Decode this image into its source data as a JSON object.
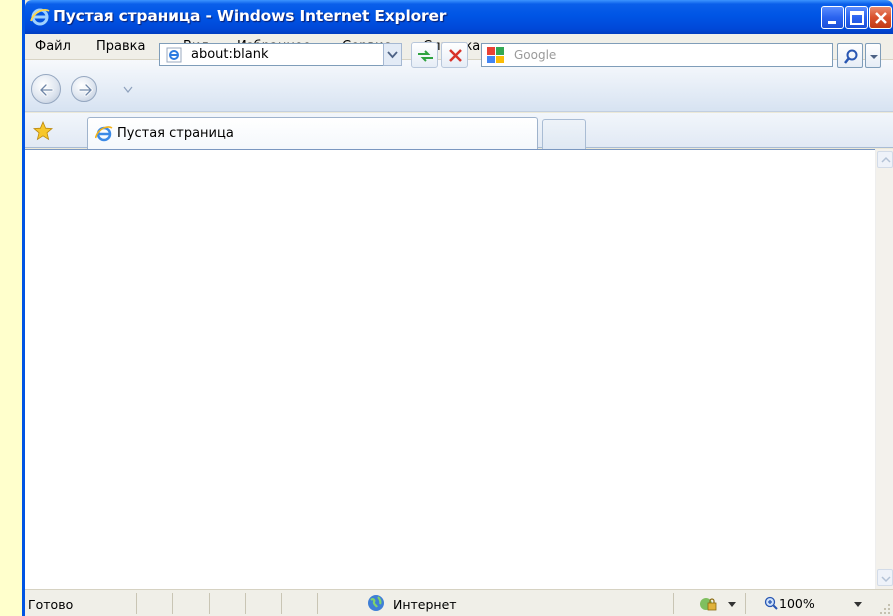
{
  "window": {
    "title": "Пустая страница - Windows Internet Explorer",
    "title_icon": "ie-logo-icon",
    "controls": [
      "minimize-icon",
      "maximize-icon",
      "close-icon"
    ]
  },
  "menu": {
    "items": [
      "Файл",
      "Правка",
      "Вид",
      "Избранное",
      "Сервис",
      "Справка"
    ]
  },
  "navigation": {
    "back_icon": "back-arrow-icon",
    "forward_icon": "forward-arrow-icon",
    "address_value": "about:blank",
    "refresh_icon": "refresh-icon",
    "stop_icon": "stop-icon",
    "search_placeholder": "Google",
    "search_provider_icon": "google-logo-icon",
    "search_button_icon": "magnifier-icon"
  },
  "tabs": {
    "favorites_icon": "favorites-star-icon",
    "active_tab_label": "Пустая страница",
    "new_tab_icon": "new-tab-icon"
  },
  "status": {
    "text": "Готово",
    "zone": "Интернет",
    "zoom": "100%"
  },
  "colors": {
    "titlebar": "#0055e5",
    "page_background": "#ffffcc",
    "chrome": "#e1e9f4"
  }
}
